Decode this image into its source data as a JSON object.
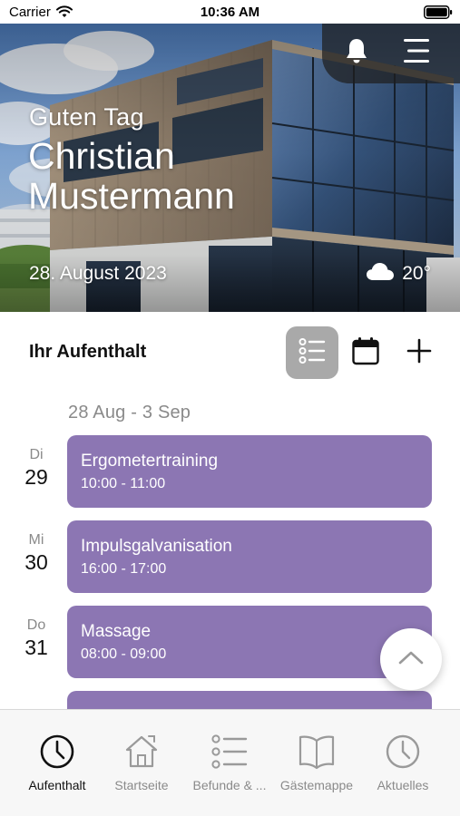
{
  "status_bar": {
    "carrier": "Carrier",
    "time": "10:36 AM"
  },
  "hero": {
    "greeting": "Guten Tag",
    "user_name": "Christian Mustermann",
    "date": "28. August 2023",
    "weather": {
      "temperature": "20°",
      "icon": "cloud-icon"
    }
  },
  "stay": {
    "title": "Ihr Aufenthalt",
    "week_range": "28 Aug - 3 Sep",
    "entries": [
      {
        "weekday": "Di",
        "day": "29",
        "title": "Ergometertraining",
        "time": "10:00 - 11:00"
      },
      {
        "weekday": "Mi",
        "day": "30",
        "title": "Impulsgalvanisation",
        "time": "16:00 - 17:00"
      },
      {
        "weekday": "Do",
        "day": "31",
        "title": "Massage",
        "time": "08:00 - 09:00"
      }
    ]
  },
  "tabs": [
    {
      "label": "Aufenthalt",
      "icon": "clock-icon",
      "active": true
    },
    {
      "label": "Startseite",
      "icon": "home-icon",
      "active": false
    },
    {
      "label": "Befunde & ...",
      "icon": "list-icon",
      "active": false
    },
    {
      "label": "Gästemappe",
      "icon": "book-icon",
      "active": false
    },
    {
      "label": "Aktuelles",
      "icon": "clock-icon",
      "active": false
    }
  ],
  "colors": {
    "accent": "#8c76b3",
    "selected_toggle": "#a9a9a9",
    "tab_active": "#111111",
    "tab_inactive": "#8a8a8a"
  }
}
